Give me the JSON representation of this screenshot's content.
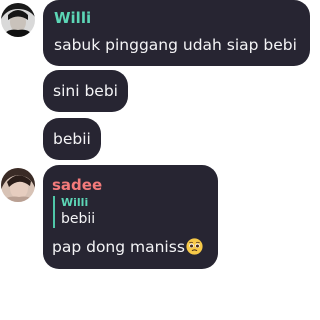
{
  "colors": {
    "bubble": "#272532",
    "name_willi": "#5cd6b6",
    "name_sadee": "#f47b7b",
    "reply_bar": "#4fc7a8",
    "text": "#f4f4f6"
  },
  "messages": [
    {
      "sender": "Willi",
      "avatar_icon": "profile-photo-icon",
      "groups": [
        {
          "text": "sabuk pinggang udah siap bebi"
        },
        {
          "text": "sini bebi"
        },
        {
          "text": "bebii"
        }
      ]
    },
    {
      "sender": "sadee",
      "avatar_icon": "profile-photo-icon",
      "reply": {
        "name": "Willi",
        "text": "bebii"
      },
      "text": "pap dong maniss",
      "emoji": "pleading-face-emoji"
    }
  ]
}
